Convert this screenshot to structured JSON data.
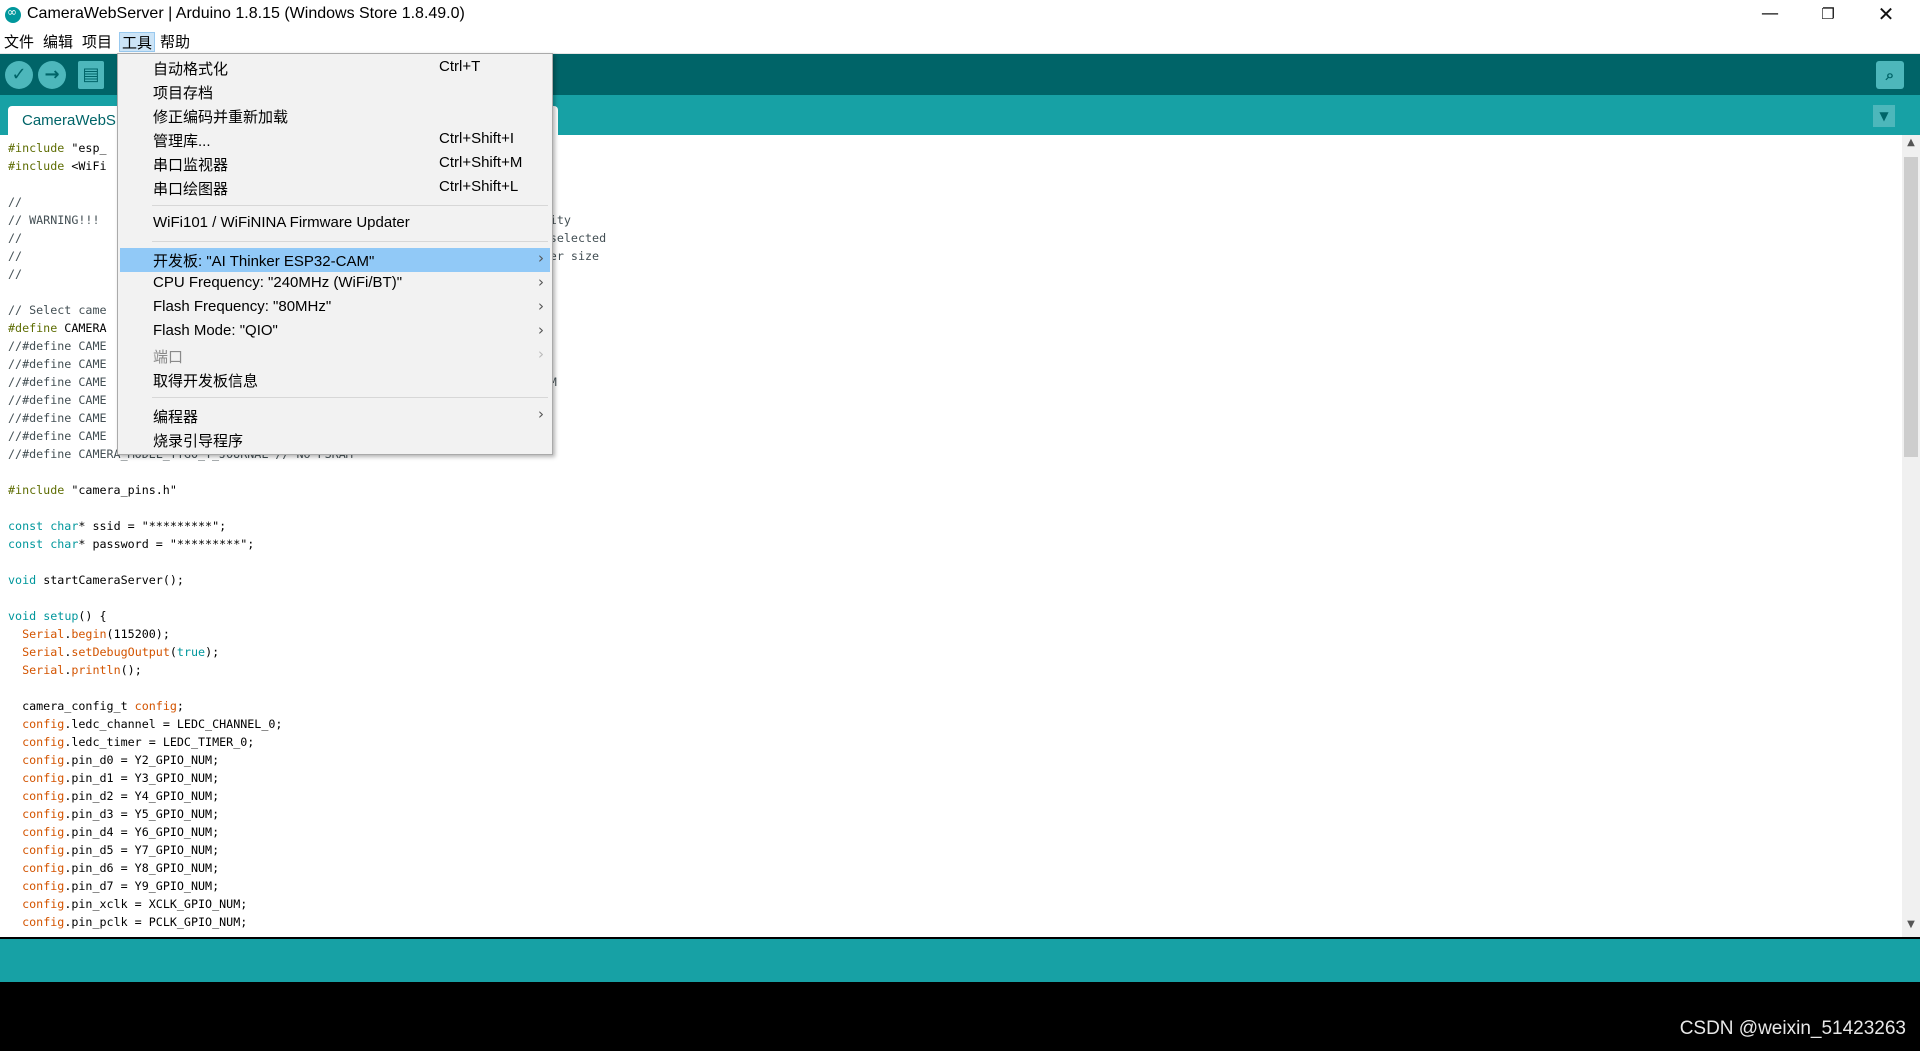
{
  "window": {
    "title": "CameraWebServer | Arduino 1.8.15 (Windows Store 1.8.49.0)",
    "minimize_icon": "—",
    "maximize_icon": "❐",
    "close_icon": "✕"
  },
  "menubar": {
    "file": "文件",
    "edit": "编辑",
    "sketch": "项目",
    "tools": "工具",
    "help": "帮助"
  },
  "toolbar": {
    "verify_icon": "✓",
    "upload_icon": "→",
    "new_icon": "▤",
    "serial_icon": "⌕"
  },
  "tabs": {
    "main_label": "CameraWebS",
    "menu_icon": "▼"
  },
  "tools_menu": {
    "items": [
      {
        "label": "自动格式化",
        "shortcut": "Ctrl+T"
      },
      {
        "label": "项目存档",
        "shortcut": ""
      },
      {
        "label": "修正编码并重新加载",
        "shortcut": ""
      },
      {
        "label": "管理库...",
        "shortcut": "Ctrl+Shift+I"
      },
      {
        "label": "串口监视器",
        "shortcut": "Ctrl+Shift+M"
      },
      {
        "label": "串口绘图器",
        "shortcut": "Ctrl+Shift+L"
      },
      {
        "label": "WiFi101 / WiFiNINA Firmware Updater",
        "shortcut": ""
      },
      {
        "label": "开发板: \"AI Thinker ESP32-CAM\"",
        "submenu": true,
        "highlighted": true
      },
      {
        "label": "CPU Frequency: \"240MHz (WiFi/BT)\"",
        "submenu": true
      },
      {
        "label": "Flash Frequency: \"80MHz\"",
        "submenu": true
      },
      {
        "label": "Flash Mode: \"QIO\"",
        "submenu": true
      },
      {
        "label": "端口",
        "submenu": true,
        "disabled": true
      },
      {
        "label": "取得开发板信息"
      },
      {
        "label": "编程器",
        "submenu": true
      },
      {
        "label": "烧录引导程序"
      }
    ],
    "arrow_icon": "›"
  },
  "code_lines": [
    "#include \"esp_",
    "#include <WiFi",
    "",
    "//",
    "// WARNING!!!                                                              ality",
    "//                                                                         s selected",
    "//                                                                         ffer size",
    "//",
    "",
    "// Select came",
    "#define CAMERA",
    "//#define CAME",
    "//#define CAME",
    "//#define CAME                                                             RAM",
    "//#define CAME",
    "//#define CAME",
    "//#define CAME",
    "//#define CAMERA_MODEL_TTGO_T_JOURNAL // No PSRAM",
    "",
    "#include \"camera_pins.h\"",
    "",
    "const char* ssid = \"*********\";",
    "const char* password = \"*********\";",
    "",
    "void startCameraServer();",
    "",
    "void setup() {",
    "  Serial.begin(115200);",
    "  Serial.setDebugOutput(true);",
    "  Serial.println();",
    "",
    "  camera_config_t config;",
    "  config.ledc_channel = LEDC_CHANNEL_0;",
    "  config.ledc_timer = LEDC_TIMER_0;",
    "  config.pin_d0 = Y2_GPIO_NUM;",
    "  config.pin_d1 = Y3_GPIO_NUM;",
    "  config.pin_d2 = Y4_GPIO_NUM;",
    "  config.pin_d3 = Y5_GPIO_NUM;",
    "  config.pin_d4 = Y6_GPIO_NUM;",
    "  config.pin_d5 = Y7_GPIO_NUM;",
    "  config.pin_d6 = Y8_GPIO_NUM;",
    "  config.pin_d7 = Y9_GPIO_NUM;",
    "  config.pin_xclk = XCLK_GPIO_NUM;",
    "  config.pin_pclk = PCLK_GPIO_NUM;"
  ],
  "scrollbar": {
    "up_icon": "▲",
    "down_icon": "▼"
  },
  "watermark": "CSDN @weixin_51423263"
}
